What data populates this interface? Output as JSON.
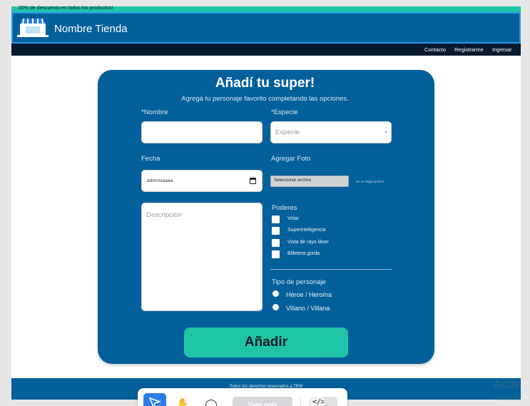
{
  "promo": {
    "text": "20% de descuento en todos los productos!"
  },
  "header": {
    "store_name": "Nombre Tienda",
    "logo_icon": "storefront-icon"
  },
  "nav": {
    "contact": "Contacto",
    "register": "Registrarme",
    "login": "Ingresar"
  },
  "form": {
    "title": "Añadí tu super!",
    "subtitle": "Agregá tu personaje favorito completando las opciones.",
    "name_label": "*Nombre",
    "name_value": "",
    "species_label": "*Especie",
    "species_placeholder": "Especie",
    "date_label": "Fecha",
    "date_placeholder": "dd/mm/aaaa",
    "photo_label": "Agregar Foto",
    "file_button": "Seleccionar archivo",
    "no_file": "No se eligió archivo",
    "description_placeholder": "Descripción",
    "powers_label": "Poderes",
    "powers": [
      {
        "label": "Volar",
        "checked": false
      },
      {
        "label": "Superinteligencia",
        "checked": false
      },
      {
        "label": "Vista de rayo láser",
        "checked": false
      },
      {
        "label": "Billetera gorda",
        "checked": false
      }
    ],
    "type_label": "Tipo de personaje",
    "types": [
      {
        "label": "Héroe / Heroína",
        "selected": false
      },
      {
        "label": "Villano / Villana",
        "selected": false
      }
    ],
    "submit_label": "Añadir"
  },
  "footer": {
    "text": "Todos los derechos reservados a TBW"
  },
  "toolbar": {
    "view_only": "View only",
    "code_icon": "</>"
  },
  "watermark": {
    "line1": "Activ",
    "line2": "Ve a Co"
  },
  "colors": {
    "primary": "#03609b",
    "accent": "#1fc4a6",
    "nav": "#061b2e"
  }
}
